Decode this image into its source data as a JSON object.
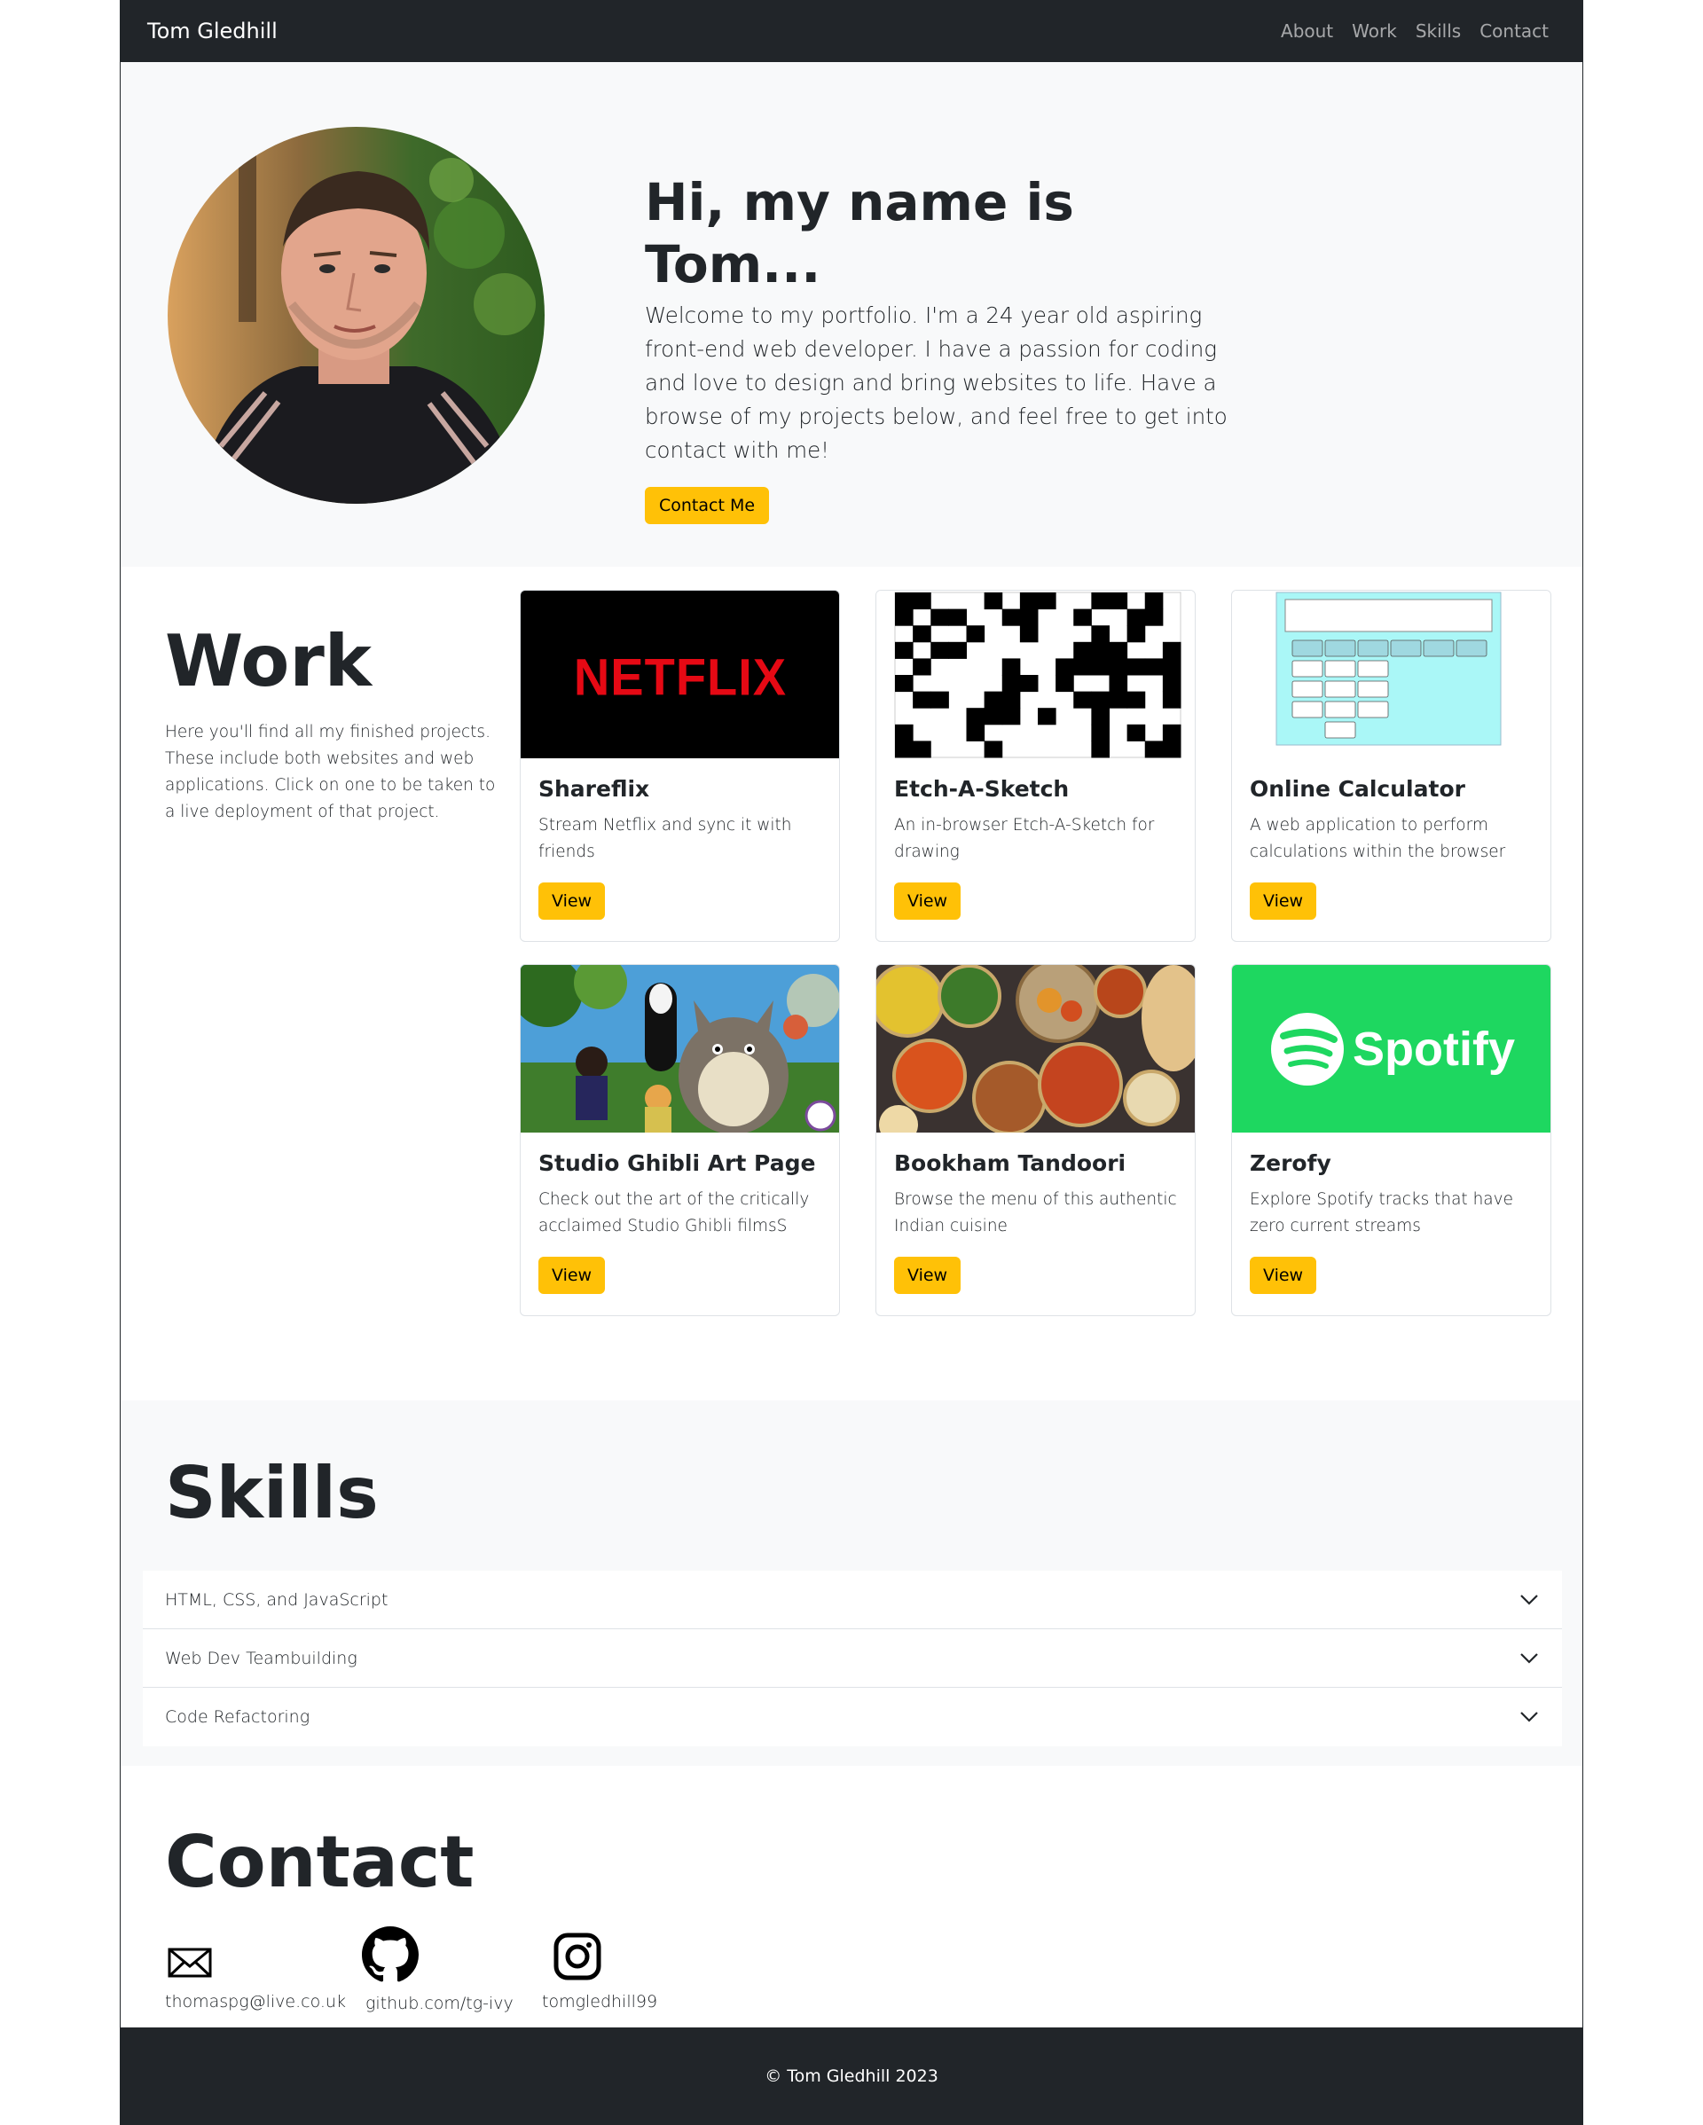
{
  "navbar": {
    "brand": "Tom Gledhill",
    "links": [
      "About",
      "Work",
      "Skills",
      "Contact"
    ]
  },
  "hero": {
    "title": "Hi, my name is Tom...",
    "body": "Welcome to my portfolio. I'm a 24 year old aspiring front-end web developer. I have a passion for coding and love to design and bring websites to life. Have a browse of my projects below, and feel free to get into contact with me!",
    "button": "Contact Me"
  },
  "work": {
    "title": "Work",
    "description": "Here you'll find all my finished projects. These include both websites and web applications. Click on one to be taken to a live deployment of that project.",
    "cards": [
      {
        "title": "Shareflix",
        "text": "Stream Netflix and sync it with friends",
        "button": "View",
        "image_text": "NETFLIX"
      },
      {
        "title": "Etch-A-Sketch",
        "text": "An in-browser Etch-A-Sketch for drawing",
        "button": "View"
      },
      {
        "title": "Online Calculator",
        "text": "A web application to perform calculations within the browser",
        "button": "View"
      },
      {
        "title": "Studio Ghibli Art Page",
        "text": "Check out the art of the critically acclaimed Studio Ghibli filmsS",
        "button": "View"
      },
      {
        "title": "Bookham Tandoori",
        "text": "Browse the menu of this authentic Indian cuisine",
        "button": "View"
      },
      {
        "title": "Zerofy",
        "text": "Explore Spotify tracks that have zero current streams",
        "button": "View",
        "image_text": "Spotify"
      }
    ]
  },
  "skills": {
    "title": "Skills",
    "items": [
      "HTML, CSS, and JavaScript",
      "Web Dev Teambuilding",
      "Code Refactoring"
    ]
  },
  "contact": {
    "title": "Contact",
    "items": [
      {
        "label": "thomaspg@live.co.uk",
        "icon": "envelope-icon"
      },
      {
        "label": "github.com/tg-ivy",
        "icon": "github-icon"
      },
      {
        "label": "tomgledhill99",
        "icon": "instagram-icon"
      }
    ]
  },
  "footer": {
    "text": "© Tom Gledhill 2023"
  },
  "colors": {
    "dark": "#212529",
    "light": "#f8f9fa",
    "warning": "#ffc107",
    "netflix_red": "#e50914",
    "spotify_green": "#1ed760",
    "calc_bg": "#aaf7f7"
  }
}
